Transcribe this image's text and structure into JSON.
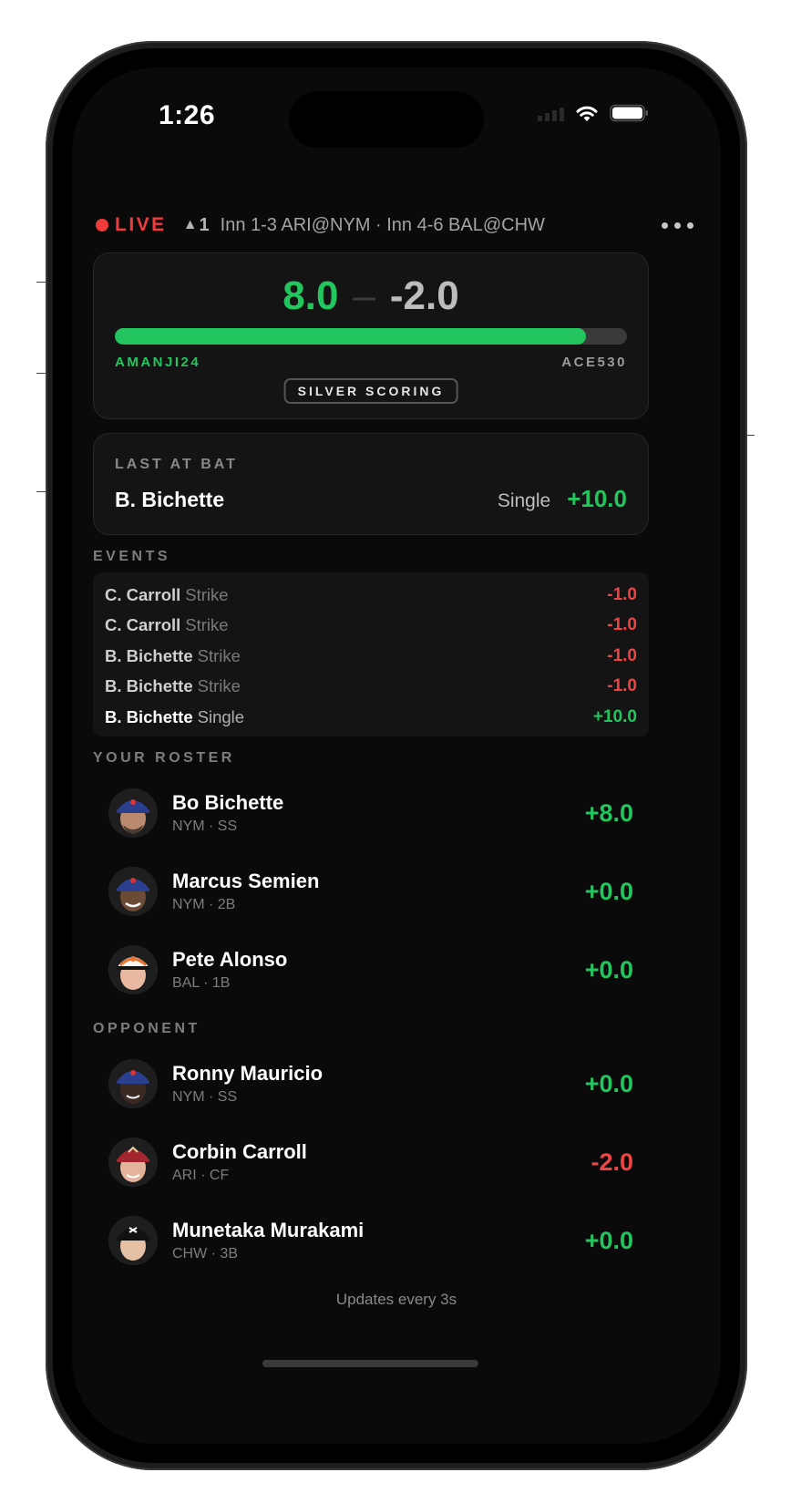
{
  "status_bar": {
    "time": "1:26"
  },
  "header": {
    "live_label": "LIVE",
    "alert_count": "1",
    "innings_text": "Inn 1-3 ARI@NYM · Inn 4-6 BAL@CHW"
  },
  "scoreboard": {
    "my_score": "8.0",
    "separator": "–",
    "opponent_score": "-2.0",
    "my_team": "AMANJI24",
    "opponent_team": "ACE530",
    "progress_fraction": 0.92,
    "scoring_badge": "SILVER SCORING"
  },
  "last_at_bat": {
    "title": "LAST AT BAT",
    "player": "B. Bichette",
    "result": "Single",
    "points": "+10.0"
  },
  "events": {
    "title": "EVENTS",
    "items": [
      {
        "player": "C. Carroll",
        "action": "Strike",
        "points": "-1.0",
        "sign": "neg"
      },
      {
        "player": "C. Carroll",
        "action": "Strike",
        "points": "-1.0",
        "sign": "neg"
      },
      {
        "player": "B. Bichette",
        "action": "Strike",
        "points": "-1.0",
        "sign": "neg"
      },
      {
        "player": "B. Bichette",
        "action": "Strike",
        "points": "-1.0",
        "sign": "neg"
      },
      {
        "player": "B. Bichette",
        "action": "Single",
        "points": "+10.0",
        "sign": "pos"
      }
    ]
  },
  "your_roster": {
    "title": "YOUR ROSTER",
    "players": [
      {
        "name": "Bo Bichette",
        "meta": "NYM · SS",
        "points": "+8.0",
        "sign": "pos"
      },
      {
        "name": "Marcus Semien",
        "meta": "NYM · 2B",
        "points": "+0.0",
        "sign": "pos"
      },
      {
        "name": "Pete Alonso",
        "meta": "BAL · 1B",
        "points": "+0.0",
        "sign": "pos"
      }
    ]
  },
  "opponent": {
    "title": "OPPONENT",
    "players": [
      {
        "name": "Ronny Mauricio",
        "meta": "NYM · SS",
        "points": "+0.0",
        "sign": "pos"
      },
      {
        "name": "Corbin Carroll",
        "meta": "ARI · CF",
        "points": "-2.0",
        "sign": "neg"
      },
      {
        "name": "Munetaka Murakami",
        "meta": "CHW · 3B",
        "points": "+0.0",
        "sign": "pos"
      }
    ]
  },
  "footer": {
    "note": "Updates every 3s"
  },
  "colors": {
    "positive": "#22c55e",
    "negative": "#ef4444",
    "live": "#ef3b3b",
    "background": "#0a0a0a",
    "card": "#141414"
  }
}
